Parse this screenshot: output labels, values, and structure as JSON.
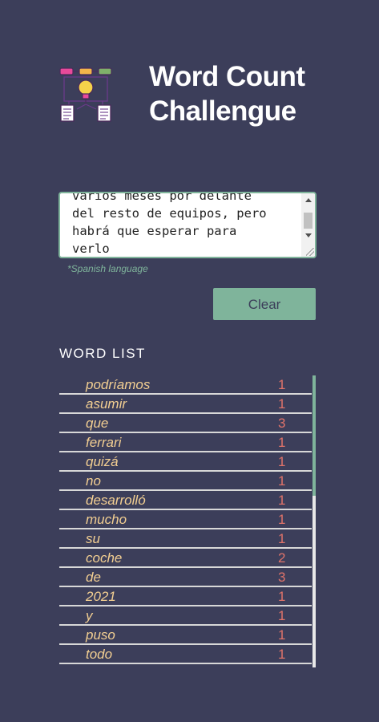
{
  "header": {
    "title_line1": "Word Count",
    "title_line2": "Challengue",
    "logo_icon": "idea-lightbulb-documents-icon"
  },
  "input": {
    "text": "varios meses por delante\ndel resto de equipos, pero\nhabrá que esperar para\nverlo",
    "language_note": "*Spanish language"
  },
  "actions": {
    "clear_label": "Clear"
  },
  "word_list": {
    "heading": "WORD LIST",
    "items": [
      {
        "word": "podríamos",
        "count": "1"
      },
      {
        "word": "asumir",
        "count": "1"
      },
      {
        "word": "que",
        "count": "3"
      },
      {
        "word": "ferrari",
        "count": "1"
      },
      {
        "word": "quizá",
        "count": "1"
      },
      {
        "word": "no",
        "count": "1"
      },
      {
        "word": "desarrolló",
        "count": "1"
      },
      {
        "word": "mucho",
        "count": "1"
      },
      {
        "word": "su",
        "count": "1"
      },
      {
        "word": "coche",
        "count": "2"
      },
      {
        "word": "de",
        "count": "3"
      },
      {
        "word": "2021",
        "count": "1"
      },
      {
        "word": "y",
        "count": "1"
      },
      {
        "word": "puso",
        "count": "1"
      },
      {
        "word": "todo",
        "count": "1"
      }
    ]
  },
  "colors": {
    "background": "#3c3e5a",
    "accent_green": "#7fb49b",
    "word_color": "#f3cf92",
    "count_color": "#e0736a",
    "title_color": "#ffffff"
  }
}
